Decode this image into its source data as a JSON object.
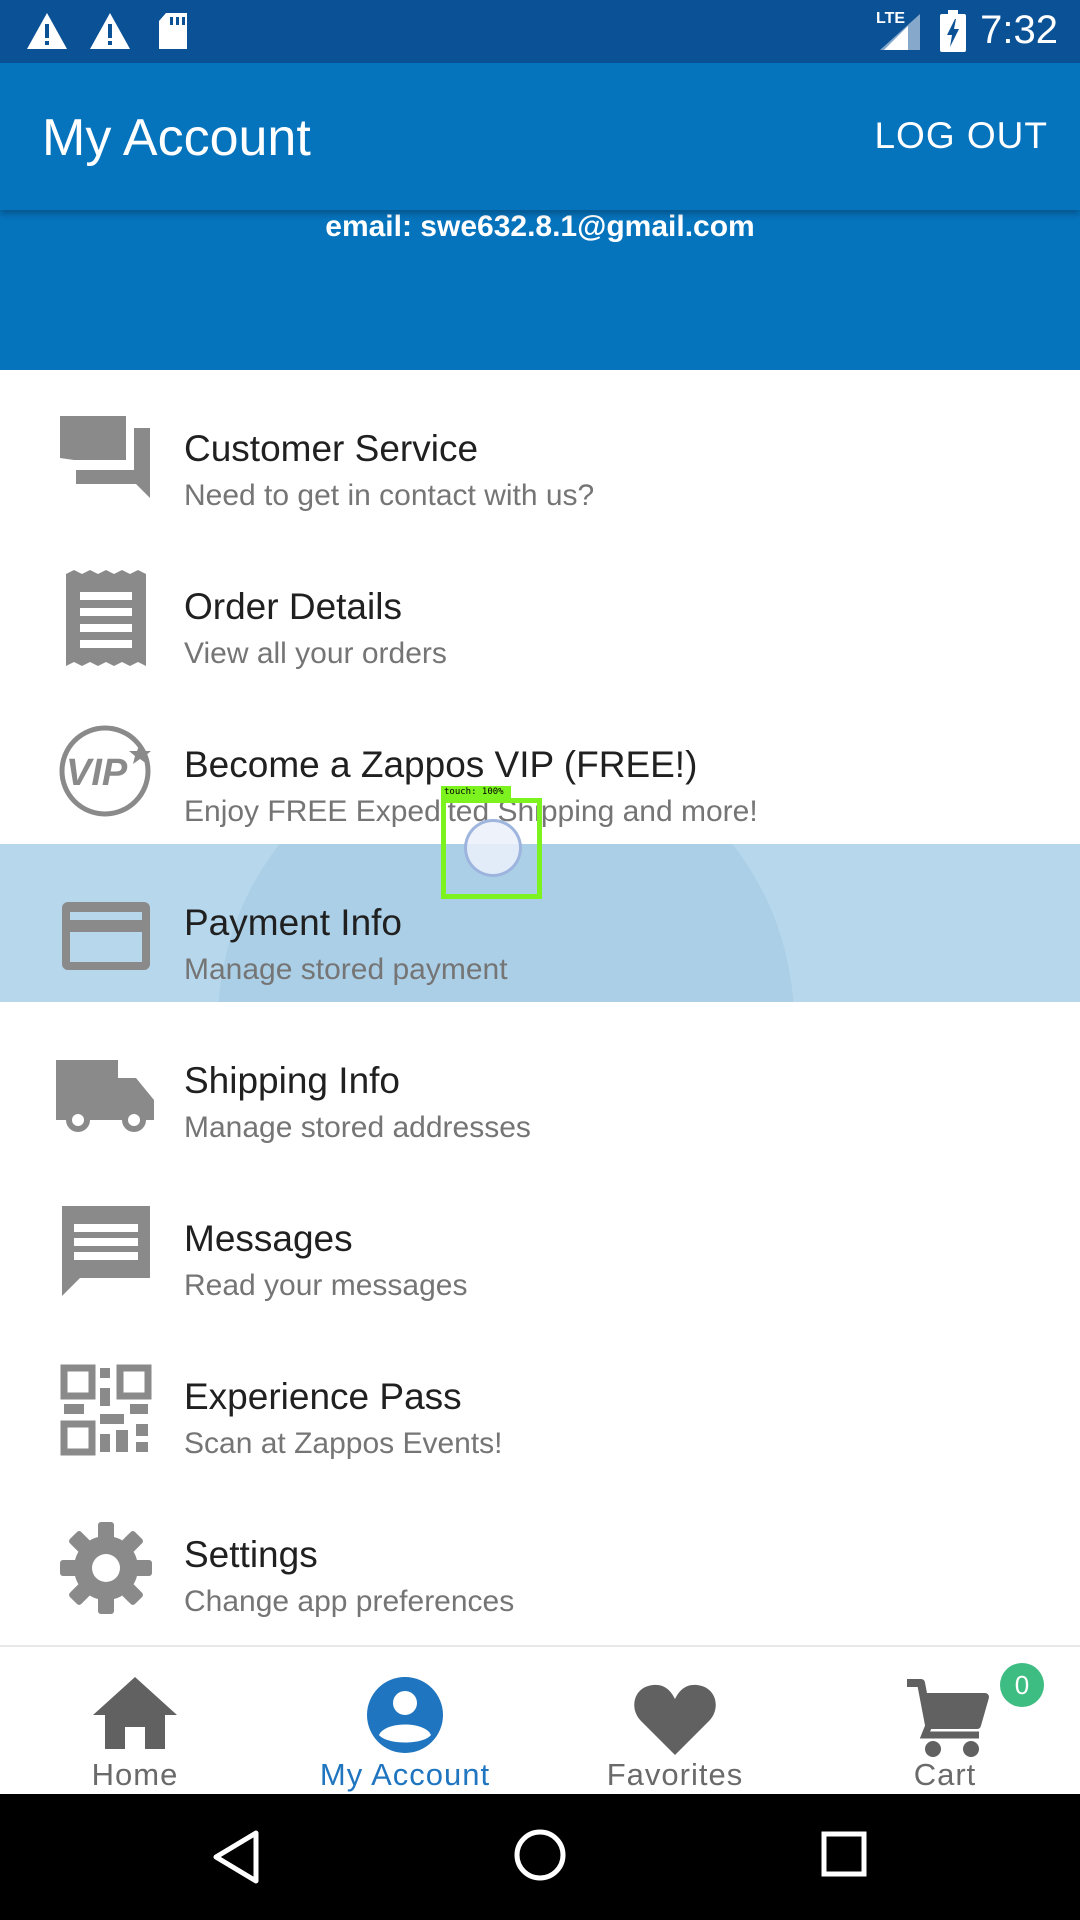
{
  "status_bar": {
    "time": "7:32",
    "network": "LTE",
    "icons": [
      "warning-icon",
      "warning-icon",
      "sd-card-icon",
      "signal-icon",
      "battery-charging-icon"
    ]
  },
  "app_bar": {
    "title": "My Account",
    "logout_label": "LOG OUT"
  },
  "account": {
    "email": "email: swe632.8.1@gmail.com"
  },
  "menu": [
    {
      "icon": "forum-icon",
      "title": "Customer Service",
      "subtitle": "Need to get in contact with us?"
    },
    {
      "icon": "receipt-icon",
      "title": "Order Details",
      "subtitle": "View all your orders"
    },
    {
      "icon": "vip-icon",
      "title": "Become a Zappos VIP (FREE!)",
      "subtitle": "Enjoy FREE Expedited Shipping and more!"
    },
    {
      "icon": "credit-card-icon",
      "title": "Payment Info",
      "subtitle": "Manage stored payment",
      "pressed": true
    },
    {
      "icon": "truck-icon",
      "title": "Shipping Info",
      "subtitle": "Manage stored addresses"
    },
    {
      "icon": "message-icon",
      "title": "Messages",
      "subtitle": "Read your messages"
    },
    {
      "icon": "qr-code-icon",
      "title": "Experience Pass",
      "subtitle": "Scan at Zappos Events!"
    },
    {
      "icon": "gear-icon",
      "title": "Settings",
      "subtitle": "Change app preferences"
    }
  ],
  "bottom_nav": [
    {
      "icon": "home-icon",
      "label": "Home"
    },
    {
      "icon": "account-circle-icon",
      "label": "My Account",
      "active": true
    },
    {
      "icon": "heart-icon",
      "label": "Favorites"
    },
    {
      "icon": "cart-icon",
      "label": "Cart",
      "badge": "0"
    }
  ],
  "touch_overlay": {
    "label": "touch: 100%"
  },
  "colors": {
    "status_bar": "#0a5196",
    "app_bar": "#0673bd",
    "active_nav": "#1f75bf",
    "pressed_row": "#b7d7ec",
    "icon_gray": "#8a8a8a",
    "badge": "#3dbd82"
  }
}
